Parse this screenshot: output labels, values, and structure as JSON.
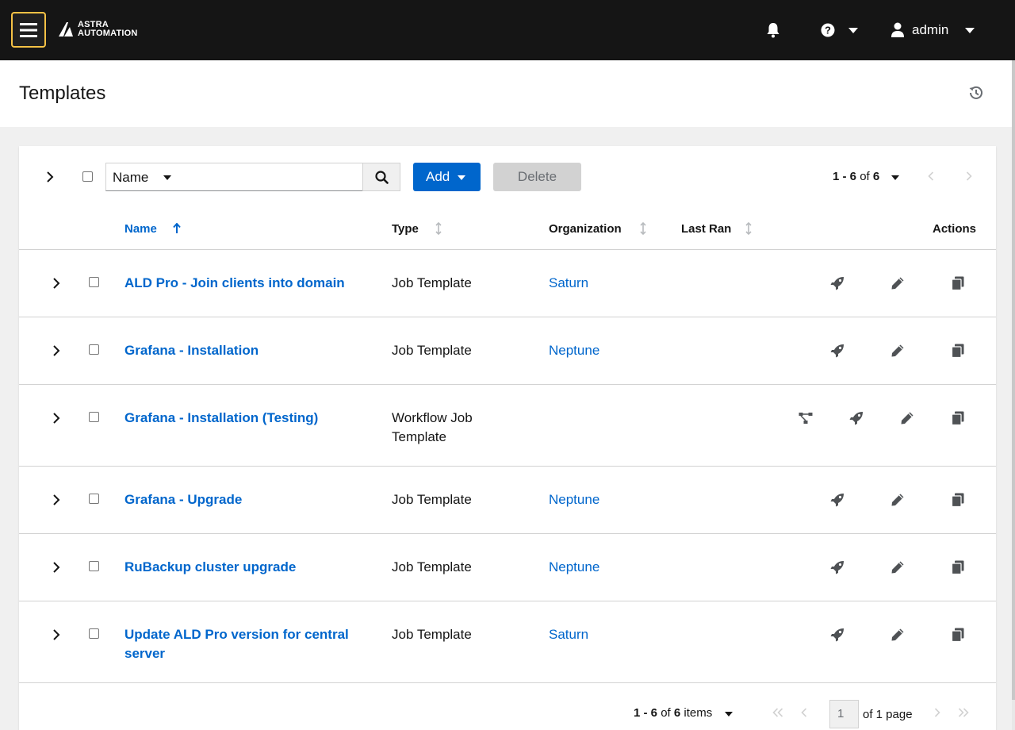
{
  "header": {
    "logo_line1": "ASTRA",
    "logo_line2": "AUTOMATION",
    "username": "admin",
    "icons": [
      "hamburger-menu-icon",
      "bell-icon",
      "question-circle-icon",
      "user-icon"
    ],
    "accent_color": "#f4c145"
  },
  "page": {
    "title": "Templates"
  },
  "toolbar": {
    "search_field_selected": "Name",
    "search_value": "",
    "add_label": "Add",
    "delete_label": "Delete",
    "pager_range": "1 - 6",
    "pager_of": "of",
    "pager_total": "6"
  },
  "table": {
    "columns": {
      "name": "Name",
      "type": "Type",
      "organization": "Organization",
      "last_ran": "Last Ran",
      "actions": "Actions"
    },
    "rows": [
      {
        "name": "ALD Pro - Join clients into domain",
        "type": "Job Template",
        "organization": "Saturn",
        "actions": [
          "launch",
          "edit",
          "copy"
        ]
      },
      {
        "name": "Grafana - Installation",
        "type": "Job Template",
        "organization": "Neptune",
        "actions": [
          "launch",
          "edit",
          "copy"
        ]
      },
      {
        "name": "Grafana - Installation (Testing)",
        "type": "Workflow Job Template",
        "organization": "",
        "actions": [
          "visualizer",
          "launch",
          "edit",
          "copy"
        ]
      },
      {
        "name": "Grafana - Upgrade",
        "type": "Job Template",
        "organization": "Neptune",
        "actions": [
          "launch",
          "edit",
          "copy"
        ]
      },
      {
        "name": "RuBackup cluster upgrade",
        "type": "Job Template",
        "organization": "Neptune",
        "actions": [
          "launch",
          "edit",
          "copy"
        ]
      },
      {
        "name": "Update ALD Pro version for central server",
        "type": "Job Template",
        "organization": "Saturn",
        "actions": [
          "launch",
          "edit",
          "copy"
        ]
      }
    ]
  },
  "pagination": {
    "range": "1 - 6",
    "of": "of",
    "total": "6",
    "items_label": "items",
    "page": "1",
    "of_page": "of 1 page"
  },
  "colors": {
    "link": "#0066cc",
    "primary_button": "#0066cc",
    "topbar": "#151515"
  }
}
